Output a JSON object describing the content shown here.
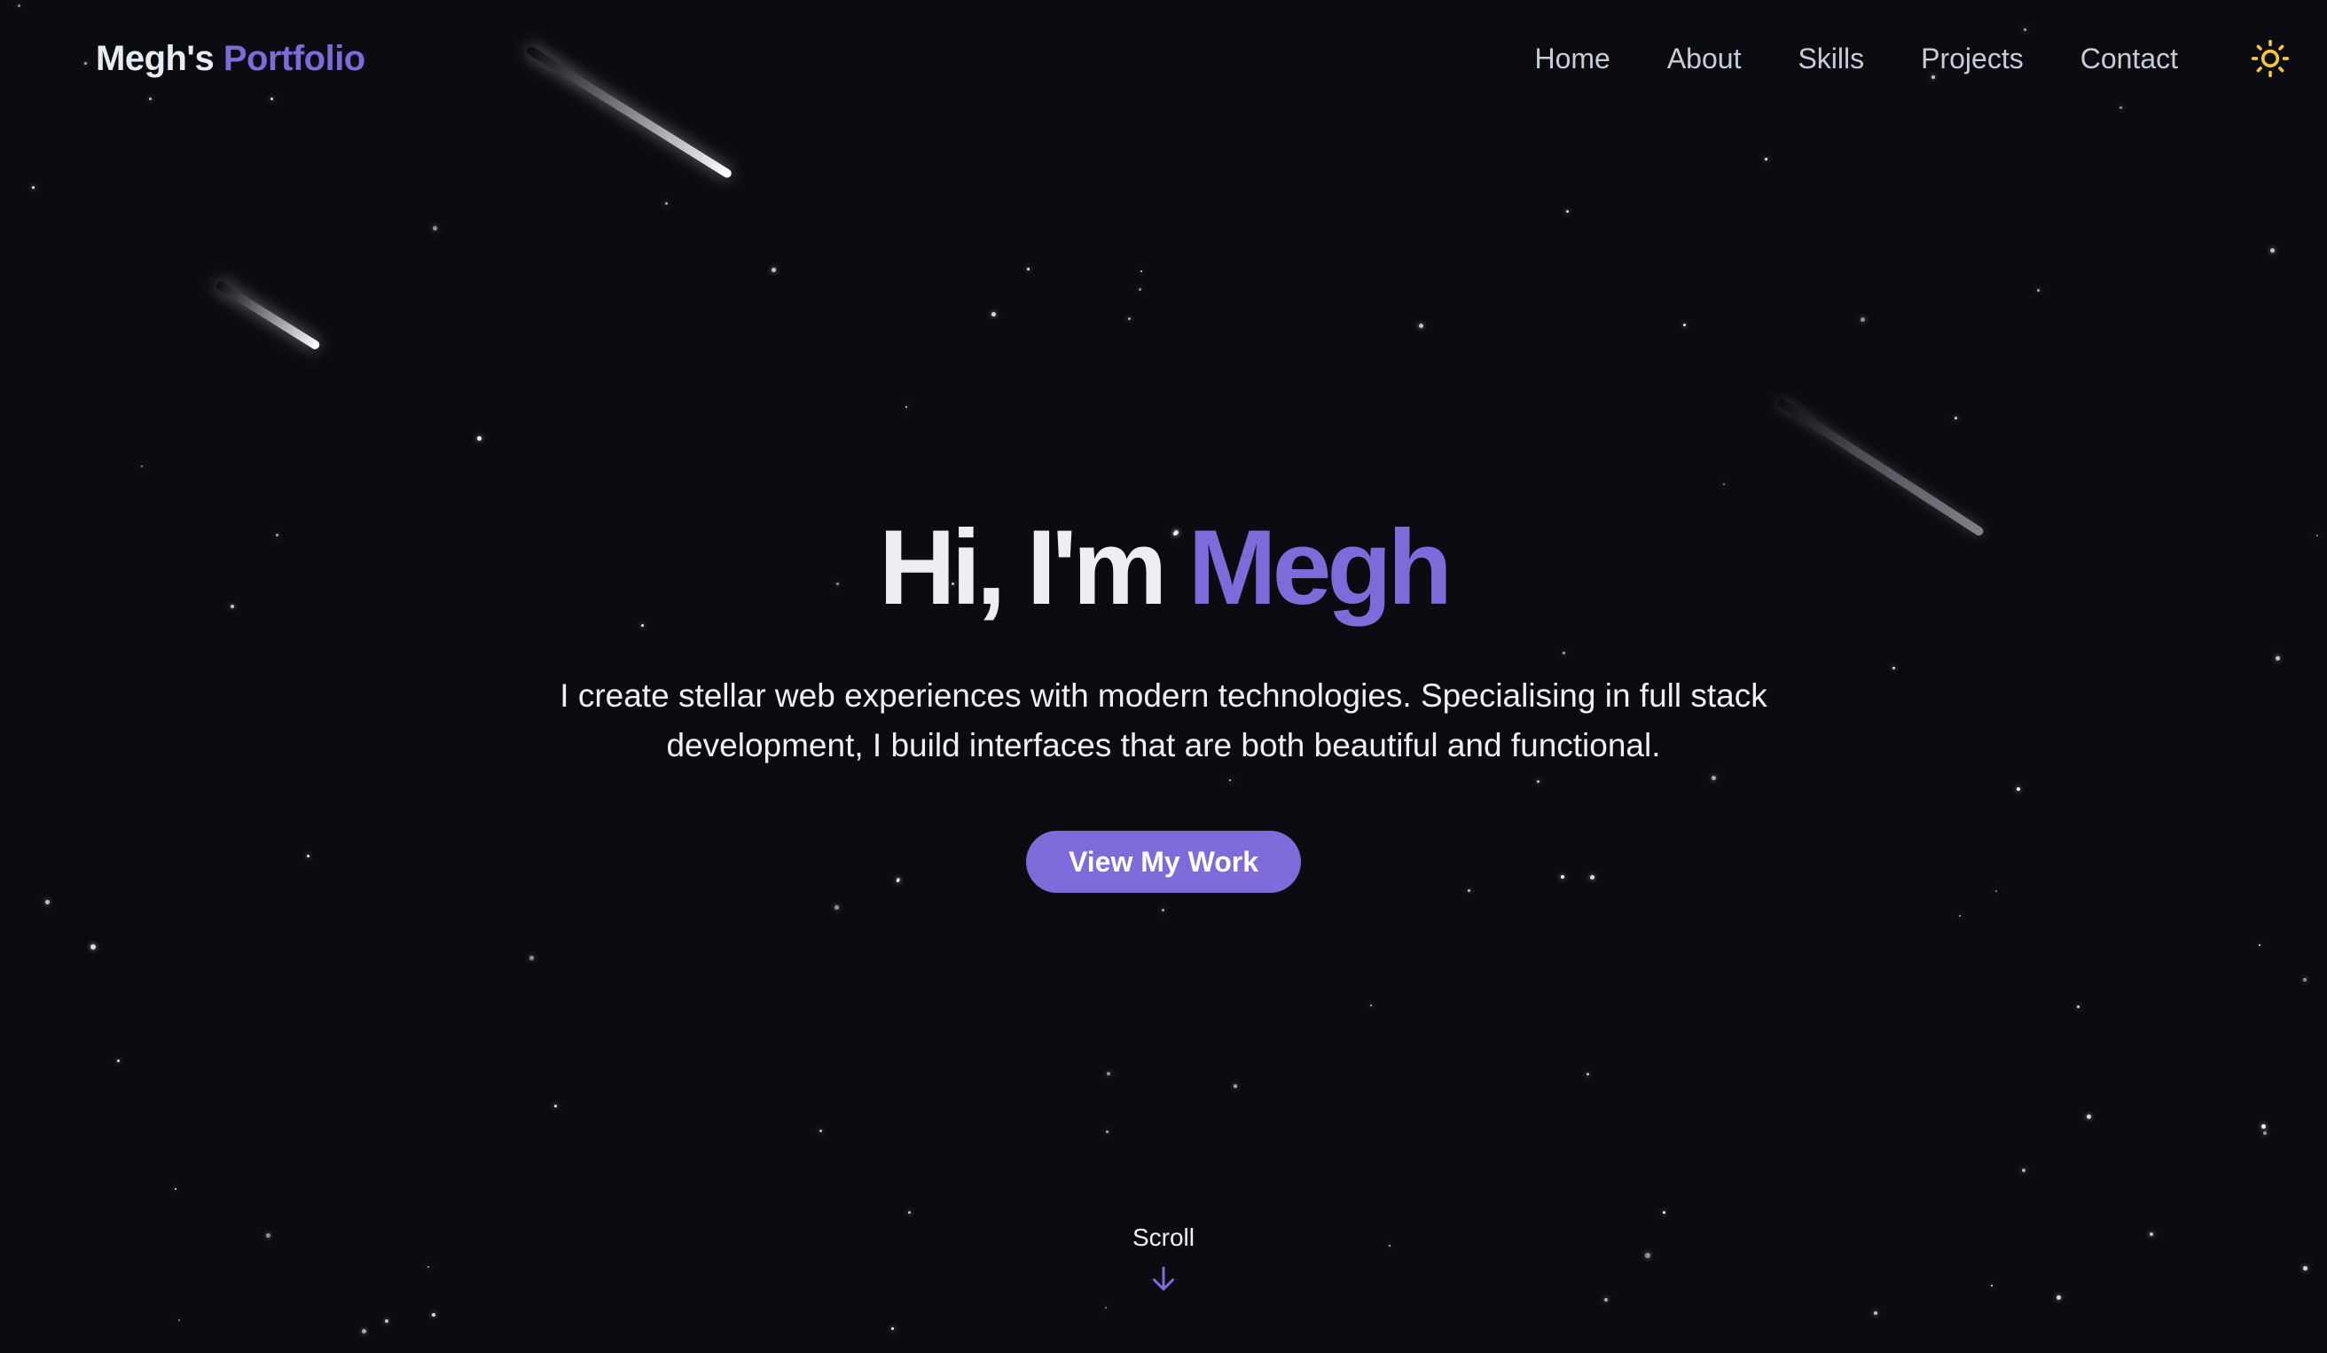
{
  "header": {
    "logo_name": "Megh's",
    "logo_accent": "Portfolio",
    "nav_items": [
      "Home",
      "About",
      "Skills",
      "Projects",
      "Contact"
    ],
    "theme_toggle_icon": "sun-icon"
  },
  "hero": {
    "title_prefix": "Hi, I'm",
    "title_name": "Megh",
    "subtitle": "I create stellar web experiences with modern technologies. Specialising in full stack development, I build interfaces that are both beautiful and functional.",
    "cta_label": "View My Work"
  },
  "scroll": {
    "label": "Scroll",
    "icon": "arrow-down-icon"
  },
  "colors": {
    "background": "#0a0c12",
    "accent": "#7e6bd9",
    "text": "#eceef4",
    "sun": "#f5c542"
  }
}
